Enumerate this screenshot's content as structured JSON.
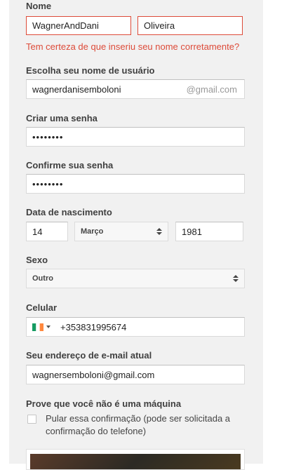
{
  "form": {
    "name": {
      "label": "Nome",
      "first": "WagnerAndDani",
      "last": "Oliveira",
      "error": "Tem certeza de que inseriu seu nome corretamente?"
    },
    "username": {
      "label": "Escolha seu nome de usuário",
      "value": "wagnerdanisemboloni",
      "suffix": "@gmail.com"
    },
    "password": {
      "label": "Criar uma senha",
      "value": "••••••••"
    },
    "confirm": {
      "label": "Confirme sua senha",
      "value": "••••••••"
    },
    "birth": {
      "label": "Data de nascimento",
      "day": "14",
      "month": "Março",
      "year": "1981"
    },
    "gender": {
      "label": "Sexo",
      "value": "Outro"
    },
    "phone": {
      "label": "Celular",
      "value": "+353831995674"
    },
    "email": {
      "label": "Seu endereço de e-mail atual",
      "value": "wagnersemboloni@gmail.com"
    },
    "captcha": {
      "label": "Prove que você não é uma máquina",
      "skip_text": "Pular essa confirmação (pode ser solicitada a confirmação do telefone)"
    }
  },
  "colors": {
    "error": "#dd4b39",
    "panel": "#f1f1f1"
  }
}
